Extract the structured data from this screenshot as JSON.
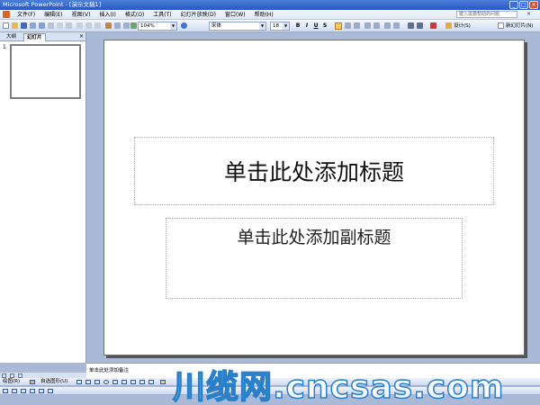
{
  "window": {
    "title": "Microsoft PowerPoint - [演示文稿1]",
    "controls": [
      "_",
      "□",
      "×"
    ]
  },
  "menubar": {
    "items": [
      "文件(F)",
      "编辑(E)",
      "视图(V)",
      "插入(I)",
      "格式(O)",
      "工具(T)",
      "幻灯片放映(D)",
      "窗口(W)",
      "帮助(H)"
    ],
    "help_search_placeholder": "键入需要帮助的问题",
    "doc_close": "×"
  },
  "toolbar": {
    "zoom": "104%",
    "font_name": "宋体",
    "font_size": "18",
    "bold": "B",
    "italic": "I",
    "underline": "U",
    "shadow": "S",
    "design_label": "设计(S)",
    "new_slide_label": "新幻灯片(N)"
  },
  "left_pane": {
    "tabs": [
      "大纲",
      "幻灯片"
    ],
    "active_tab": 1,
    "close": "×",
    "slide_number": "1"
  },
  "slide": {
    "title_placeholder": "单击此处添加标题",
    "subtitle_placeholder": "单击此处添加副标题"
  },
  "notes": {
    "placeholder": "单击此处添加备注"
  },
  "drawing_toolbar": {
    "draw_label": "绘图(R)",
    "autoshapes_label": "自选图形(U)"
  },
  "watermark": {
    "text": "川缆网.cncsas.com"
  },
  "colors": {
    "titlebar": "#2857c5",
    "workspace": "#a9b9d6",
    "active_button": "#f7c86a",
    "watermark_outline": "#2a7fc9"
  }
}
